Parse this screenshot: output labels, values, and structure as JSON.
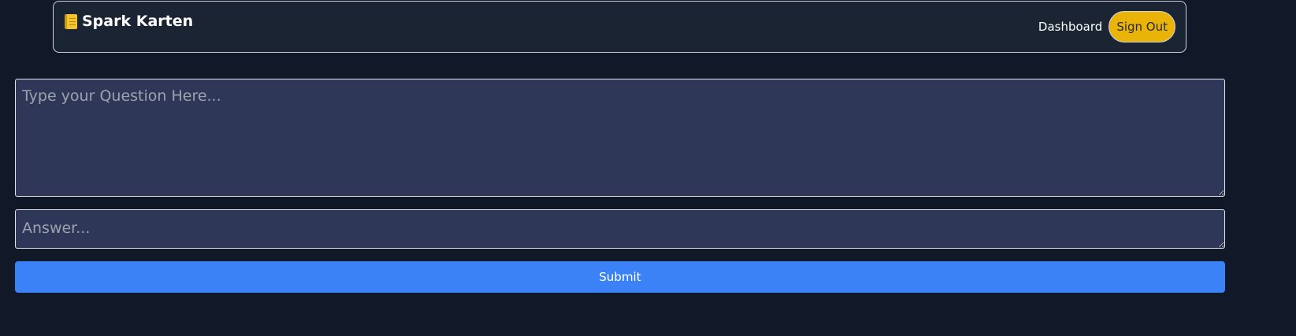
{
  "app": {
    "title": "Spark Karten",
    "logo_icon": "notebook-icon"
  },
  "nav": {
    "dashboard_label": "Dashboard",
    "signout_label": "Sign Out"
  },
  "form": {
    "question_value": "",
    "question_placeholder": "Type your Question Here...",
    "answer_value": "",
    "answer_placeholder": "Answer...",
    "submit_label": "Submit"
  },
  "colors": {
    "background": "#111827",
    "navbar": "#1b2432",
    "input_bg": "#2e3757",
    "accent_yellow": "#eab308",
    "submit_blue": "#3b82f6"
  }
}
